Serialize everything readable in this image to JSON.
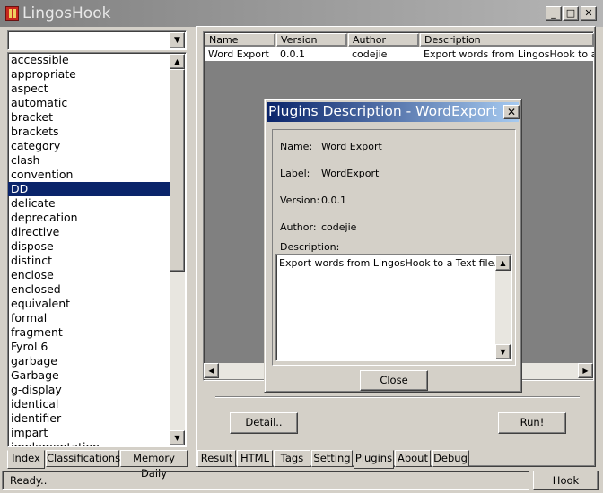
{
  "window": {
    "title": "LingosHook",
    "minimize_glyph": "_",
    "maximize_glyph": "□",
    "close_glyph": "✕"
  },
  "left": {
    "combo_value": "",
    "words": [
      "accessible",
      "appropriate",
      "aspect",
      "automatic",
      "bracket",
      "brackets",
      "category",
      "clash",
      "convention",
      "DD",
      "delicate",
      "deprecation",
      "directive",
      "dispose",
      "distinct",
      "enclose",
      "enclosed",
      "equivalent",
      "formal",
      "fragment",
      "Fyrol 6",
      "garbage",
      "Garbage",
      "g-display",
      "identical",
      "identifier",
      "impart",
      "implementation"
    ],
    "selected_word": "DD",
    "tabs": [
      "Index",
      "Classifications",
      "Memory Daily"
    ],
    "active_tab": "Index"
  },
  "plugins": {
    "columns": [
      "Name",
      "Version",
      "Author",
      "Description"
    ],
    "rows": [
      {
        "name": "Word Export",
        "version": "0.0.1",
        "author": "codejie",
        "description": "Export words from LingosHook to a ..."
      }
    ],
    "detail_label": "Detail..",
    "run_label": "Run!"
  },
  "right_tabs": {
    "items": [
      "Result",
      "HTML",
      "Tags",
      "Setting",
      "Plugins",
      "About",
      "Debug"
    ],
    "active": "Plugins"
  },
  "status": {
    "text": "Ready..",
    "hook_label": "Hook"
  },
  "dialog": {
    "title": "Plugins  Description - WordExport",
    "name_label": "Name:",
    "name_value": "Word Export",
    "label_label": "Label:",
    "label_value": "WordExport",
    "version_label": "Version:",
    "version_value": "0.0.1",
    "author_label": "Author:",
    "author_value": "codejie",
    "description_label": "Description:",
    "description_value": "Export words from LingosHook to a Text file.",
    "close_label": "Close"
  },
  "colors": {
    "selection": "#0a246a",
    "face": "#d4d0c8"
  }
}
